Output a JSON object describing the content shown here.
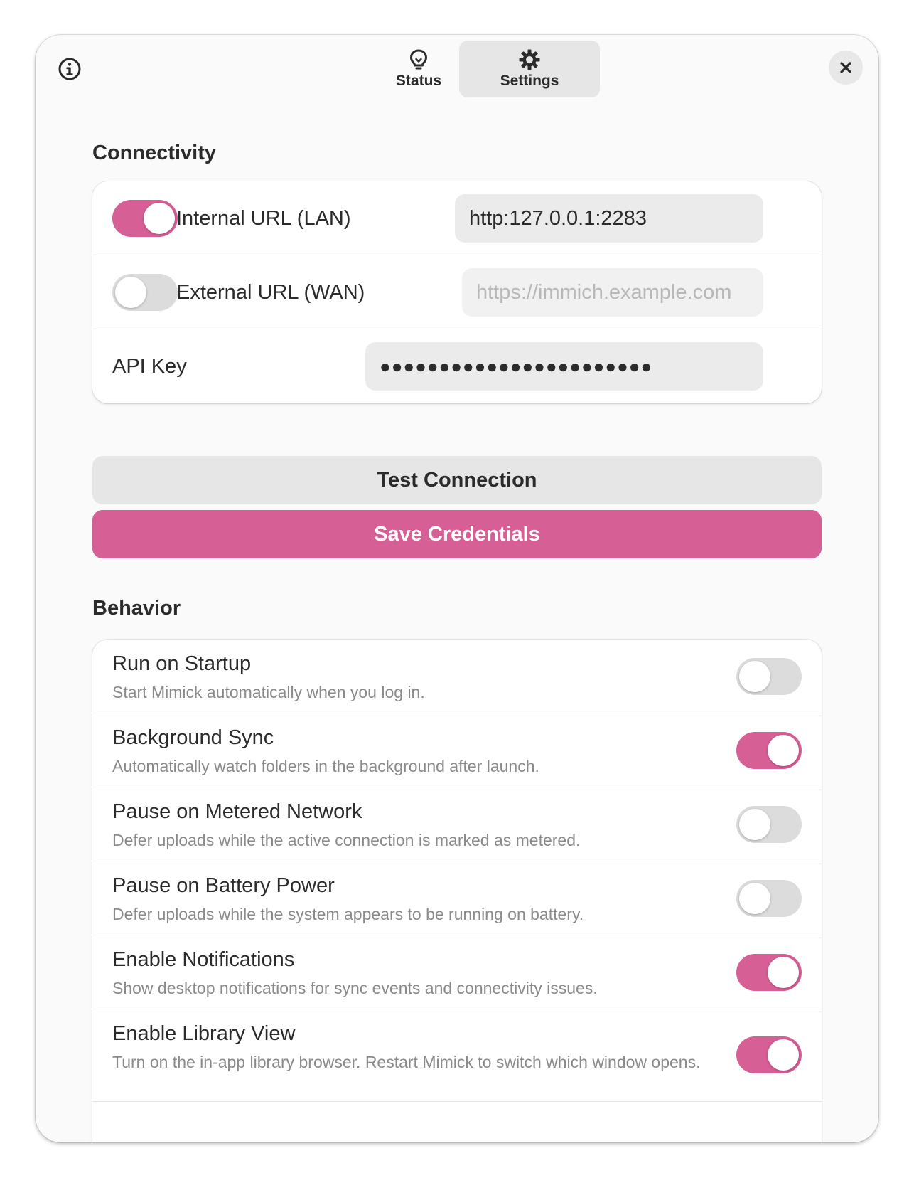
{
  "header": {
    "info_icon": "info-icon",
    "close_icon": "close-icon",
    "tabs": [
      {
        "label": "Status",
        "icon": "lightbulb-icon",
        "active": false
      },
      {
        "label": "Settings",
        "icon": "gear-icon",
        "active": true
      }
    ]
  },
  "connectivity": {
    "title": "Connectivity",
    "internal": {
      "label": "Internal URL (LAN)",
      "enabled": true,
      "value": "http:127.0.0.1:2283",
      "placeholder": ""
    },
    "external": {
      "label": "External URL (WAN)",
      "enabled": false,
      "value": "",
      "placeholder": "https://immich.example.com"
    },
    "api_key": {
      "label": "API Key",
      "masked": "●●●●●●●●●●●●●●●●●●●●●●●"
    },
    "test_button": "Test Connection",
    "save_button": "Save Credentials"
  },
  "behavior": {
    "title": "Behavior",
    "items": [
      {
        "title": "Run on Startup",
        "description": "Start Mimick automatically when you log in.",
        "enabled": false
      },
      {
        "title": "Background Sync",
        "description": "Automatically watch folders in the background after launch.",
        "enabled": true
      },
      {
        "title": "Pause on Metered Network",
        "description": "Defer uploads while the active connection is marked as metered.",
        "enabled": false
      },
      {
        "title": "Pause on Battery Power",
        "description": "Defer uploads while the system appears to be running on battery.",
        "enabled": false
      },
      {
        "title": "Enable Notifications",
        "description": "Show desktop notifications for sync events and connectivity issues.",
        "enabled": true
      },
      {
        "title": "Enable Library View",
        "description": "Turn on the in-app library browser. Restart Mimick to switch which window opens.",
        "enabled": true
      }
    ]
  },
  "colors": {
    "accent": "#d65f96",
    "window_bg": "#fafafa",
    "card_bg": "#ffffff"
  }
}
